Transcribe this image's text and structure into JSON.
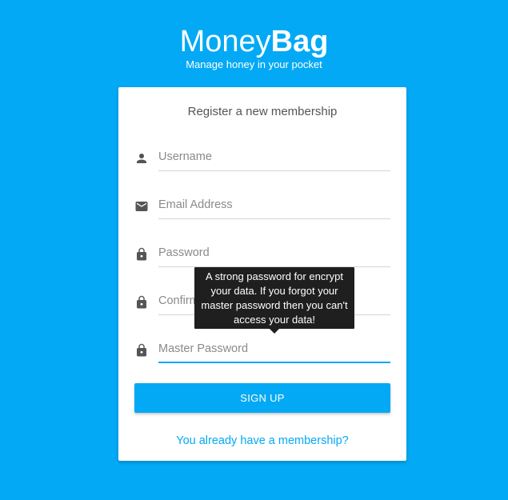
{
  "brand": {
    "name_light": "Money",
    "name_bold": "Bag",
    "tagline": "Manage honey in your pocket"
  },
  "form": {
    "title": "Register a new membership",
    "fields": [
      {
        "placeholder": "Username",
        "value": "",
        "icon": "person-icon"
      },
      {
        "placeholder": "Email Address",
        "value": "",
        "icon": "email-icon"
      },
      {
        "placeholder": "Password",
        "value": "",
        "icon": "lock-icon"
      },
      {
        "placeholder": "Confirm Password",
        "value": "",
        "icon": "lock-icon"
      },
      {
        "placeholder": "Master Password",
        "value": "",
        "icon": "lock-icon"
      }
    ],
    "submit_label": "SIGN UP",
    "login_link": "You already have a membership?"
  },
  "tooltip": {
    "text": "A strong password for encrypt your data. If you forgot your master password then you can't access your data!"
  },
  "colors": {
    "accent": "#03A9F4",
    "tooltip_bg": "#1f1f1f",
    "icon": "#555555"
  }
}
